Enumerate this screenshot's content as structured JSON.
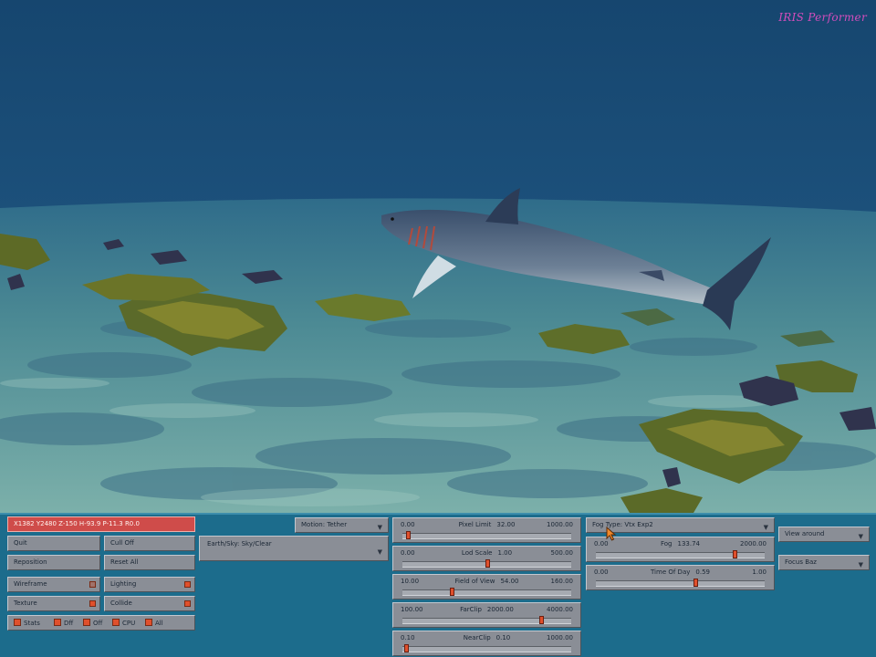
{
  "brand": "IRIS Performer",
  "scene": {
    "water_color": "#1d4f7d",
    "floor_color": "#4d8c92"
  },
  "position_readout": "X1382 Y2480 Z-150 H-93.9 P-11.3 R0.0",
  "buttons": {
    "quit": "Quit",
    "cull": "Cull Off",
    "reposition": "Reposition",
    "reset_all": "Reset All",
    "wireframe": "Wireframe",
    "lighting": "Lighting",
    "texture": "Texture",
    "collide": "Collide",
    "motion": "Motion: Tether",
    "view_around": "View around",
    "focus": "Focus Baz"
  },
  "earth_sky": "Earth/Sky: Sky/Clear",
  "fog_type": "Fog Type: Vtx Exp2",
  "stats": {
    "label": "Stats",
    "options": [
      "Dff",
      "Off",
      "CPU",
      "All"
    ]
  },
  "sliders": [
    {
      "id": "pixel-limit",
      "min": "0.00",
      "max": "1000.00",
      "name": "Pixel Limit",
      "value": "32.00",
      "fraction": 0.032
    },
    {
      "id": "lod-scale",
      "min": "0.00",
      "max": "500.00",
      "name": "Lod Scale",
      "value": "1.00",
      "fraction": 0.5
    },
    {
      "id": "field-of-view",
      "min": "10.00",
      "max": "160.00",
      "name": "Field of View",
      "value": "54.00",
      "fraction": 0.293
    },
    {
      "id": "far-clip",
      "min": "100.00",
      "max": "4000.00",
      "name": "FarClip",
      "value": "2000.00",
      "fraction": 0.82
    },
    {
      "id": "near-clip",
      "min": "0.10",
      "max": "1000.00",
      "name": "NearClip",
      "value": "0.10",
      "fraction": 0.0001
    },
    {
      "id": "fog",
      "min": "0.00",
      "max": "2000.00",
      "name": "Fog",
      "value": "133.74",
      "fraction": 0.82
    },
    {
      "id": "time-of-day",
      "min": "0.00",
      "max": "1.00",
      "name": "Time Of Day",
      "value": "0.59",
      "fraction": 0.59
    }
  ]
}
